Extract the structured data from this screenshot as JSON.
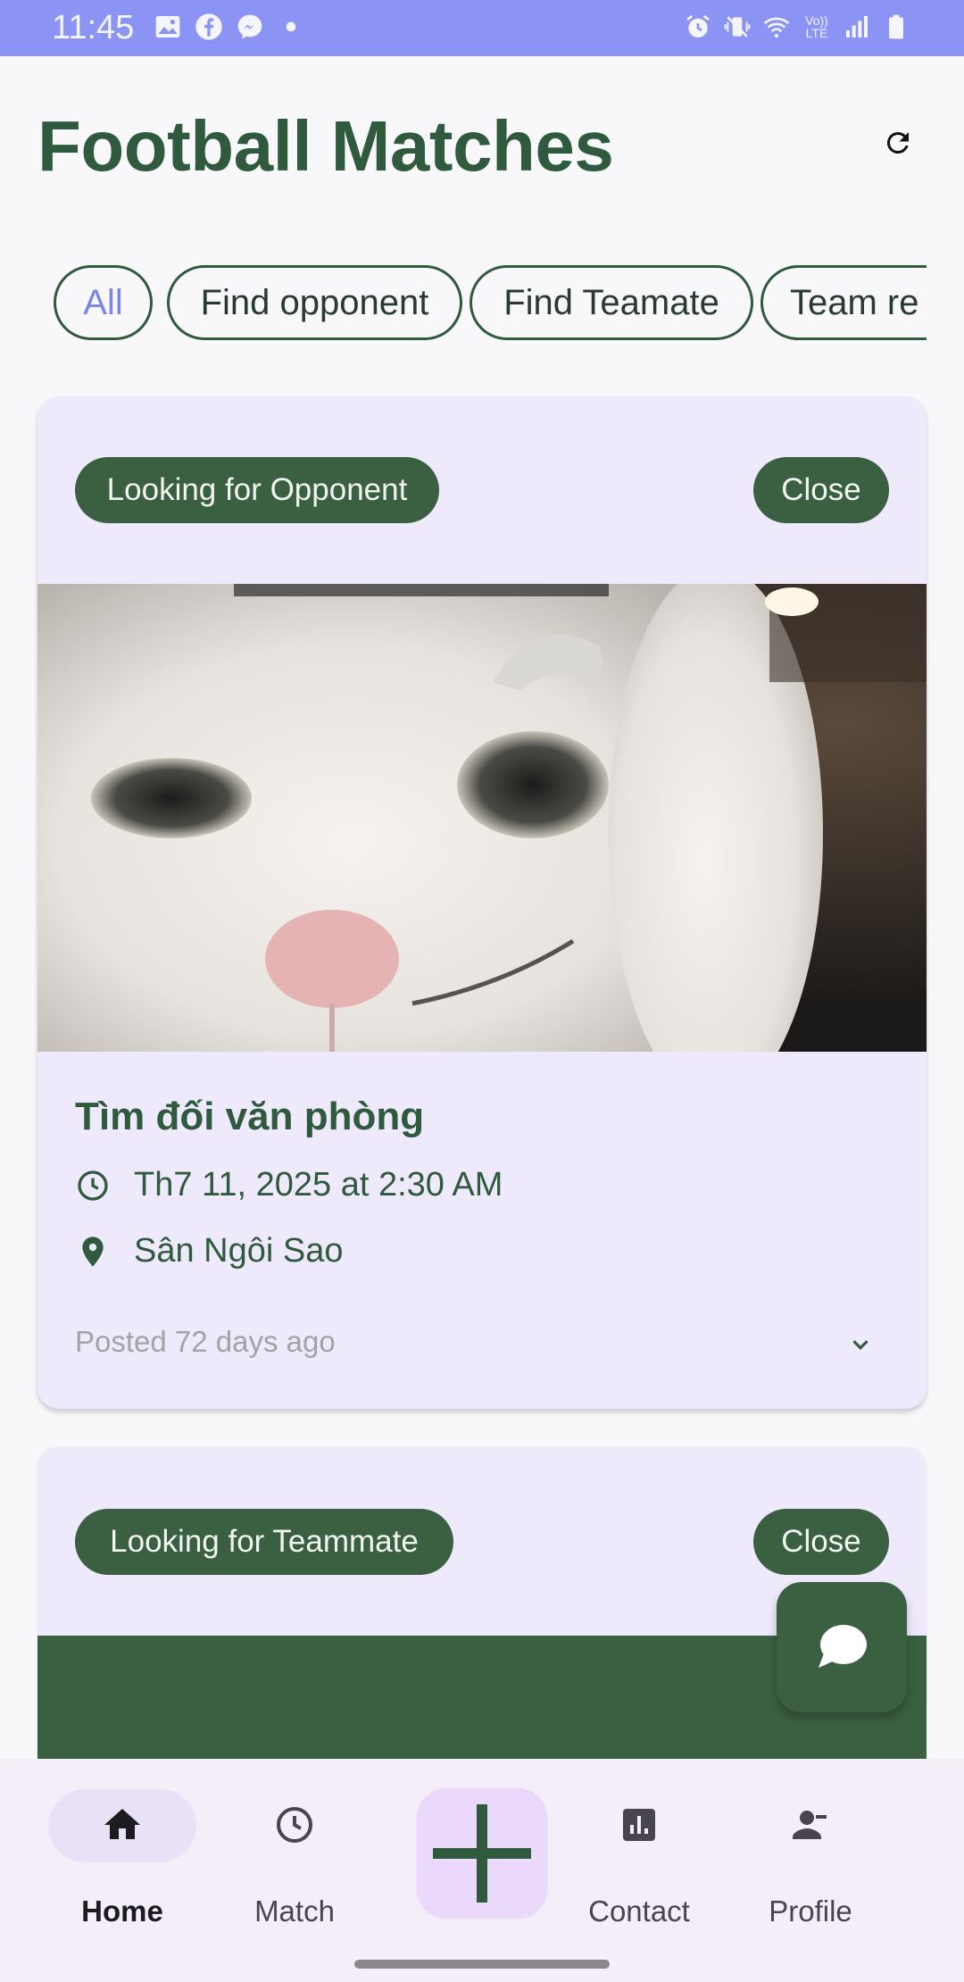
{
  "status_bar": {
    "time": "11:45",
    "left_icons": [
      "gallery-icon",
      "facebook-icon",
      "messenger-icon",
      "dot-icon"
    ],
    "right_icons": [
      "alarm-icon",
      "vibrate-icon",
      "wifi-icon",
      "volte-icon",
      "signal-icon",
      "battery-icon"
    ],
    "volte_label": "Vo)) LTE"
  },
  "header": {
    "title": "Football Matches",
    "refresh_icon": "refresh-icon"
  },
  "filters": {
    "selected": "All",
    "chips": [
      "All",
      "Find opponent",
      "Find Teamate",
      "Team re"
    ]
  },
  "cards": [
    {
      "tag": "Looking for Opponent",
      "action": "Close",
      "image_description": "white cat raising one eyebrow",
      "title": "Tìm đối văn phòng",
      "datetime": "Th7 11, 2025 at 2:30 AM",
      "location": "Sân Ngôi Sao",
      "posted": "Posted 72 days ago"
    },
    {
      "tag": "Looking for Teammate",
      "action": "Close"
    }
  ],
  "fab": {
    "icon": "chat-bubble-icon"
  },
  "bottom_nav": {
    "items": [
      {
        "label": "Home",
        "icon": "home-icon",
        "active": true
      },
      {
        "label": "Match",
        "icon": "clock-icon",
        "active": false
      },
      {
        "label": "Contact",
        "icon": "bar-chart-icon",
        "active": false
      },
      {
        "label": "Profile",
        "icon": "person-icon",
        "active": false
      }
    ],
    "add_icon": "plus-icon"
  },
  "colors": {
    "status_bar": "#8b93f4",
    "primary_green": "#3a5f41",
    "card_bg": "#efe9fc",
    "chip_selected_text": "#7b85e6"
  }
}
